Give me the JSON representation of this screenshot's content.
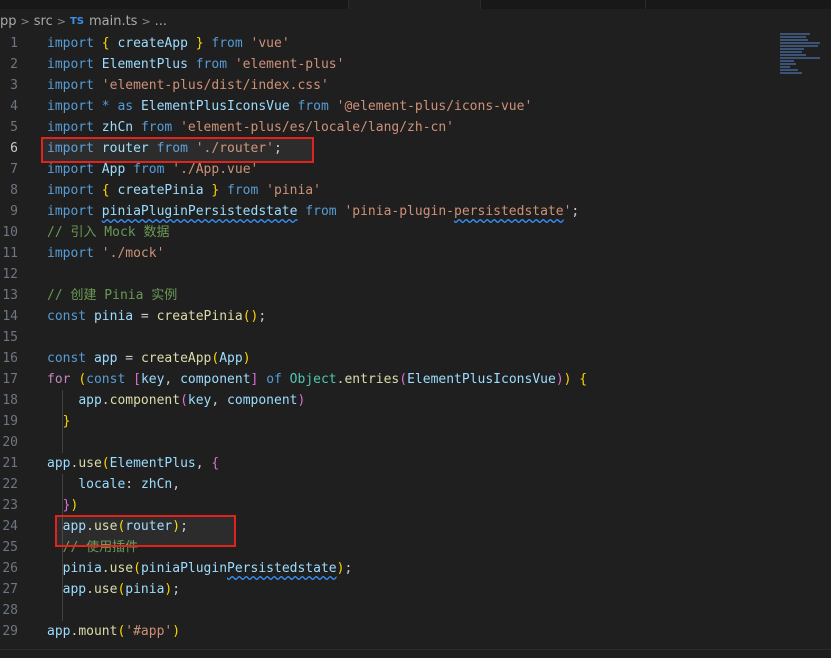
{
  "breadcrumb": {
    "items": [
      "pp",
      "src",
      "main.ts",
      "..."
    ],
    "file_icon": "TS",
    "separator": ">"
  },
  "editor": {
    "current_line": 6,
    "lines": [
      {
        "n": "1",
        "tokens": [
          [
            "kw",
            "import"
          ],
          [
            "plain",
            " "
          ],
          [
            "br1",
            "{"
          ],
          [
            "plain",
            " "
          ],
          [
            "var",
            "createApp"
          ],
          [
            "plain",
            " "
          ],
          [
            "br1",
            "}"
          ],
          [
            "plain",
            " "
          ],
          [
            "kw",
            "from"
          ],
          [
            "plain",
            " "
          ],
          [
            "str",
            "'vue'"
          ]
        ]
      },
      {
        "n": "2",
        "tokens": [
          [
            "kw",
            "import"
          ],
          [
            "plain",
            " "
          ],
          [
            "var",
            "ElementPlus"
          ],
          [
            "plain",
            " "
          ],
          [
            "kw",
            "from"
          ],
          [
            "plain",
            " "
          ],
          [
            "str",
            "'element-plus'"
          ]
        ]
      },
      {
        "n": "3",
        "tokens": [
          [
            "kw",
            "import"
          ],
          [
            "plain",
            " "
          ],
          [
            "str",
            "'element-plus/dist/index.css'"
          ]
        ]
      },
      {
        "n": "4",
        "tokens": [
          [
            "kw",
            "import"
          ],
          [
            "plain",
            " "
          ],
          [
            "kw",
            "*"
          ],
          [
            "plain",
            " "
          ],
          [
            "kw",
            "as"
          ],
          [
            "plain",
            " "
          ],
          [
            "var",
            "ElementPlusIconsVue"
          ],
          [
            "plain",
            " "
          ],
          [
            "kw",
            "from"
          ],
          [
            "plain",
            " "
          ],
          [
            "str",
            "'@element-plus/icons-vue'"
          ]
        ]
      },
      {
        "n": "5",
        "tokens": [
          [
            "kw",
            "import"
          ],
          [
            "plain",
            " "
          ],
          [
            "var",
            "zhCn"
          ],
          [
            "plain",
            " "
          ],
          [
            "kw",
            "from"
          ],
          [
            "plain",
            " "
          ],
          [
            "str",
            "'element-plus/es/locale/lang/zh-cn'"
          ]
        ]
      },
      {
        "n": "6",
        "tokens": [
          [
            "kw",
            "import"
          ],
          [
            "plain",
            " "
          ],
          [
            "var",
            "router"
          ],
          [
            "plain",
            " "
          ],
          [
            "kw",
            "from"
          ],
          [
            "plain",
            " "
          ],
          [
            "str",
            "'./router'"
          ],
          [
            "plain",
            ";"
          ]
        ]
      },
      {
        "n": "7",
        "tokens": [
          [
            "kw",
            "import"
          ],
          [
            "plain",
            " "
          ],
          [
            "var",
            "App"
          ],
          [
            "plain",
            " "
          ],
          [
            "kw",
            "from"
          ],
          [
            "plain",
            " "
          ],
          [
            "str",
            "'./App.vue'"
          ]
        ]
      },
      {
        "n": "8",
        "tokens": [
          [
            "kw",
            "import"
          ],
          [
            "plain",
            " "
          ],
          [
            "br1",
            "{"
          ],
          [
            "plain",
            " "
          ],
          [
            "var",
            "createPinia"
          ],
          [
            "plain",
            " "
          ],
          [
            "br1",
            "}"
          ],
          [
            "plain",
            " "
          ],
          [
            "kw",
            "from"
          ],
          [
            "plain",
            " "
          ],
          [
            "str",
            "'pinia'"
          ]
        ]
      },
      {
        "n": "9",
        "tokens": [
          [
            "kw",
            "import"
          ],
          [
            "plain",
            " "
          ],
          [
            "var squig",
            "piniaPluginPersistedstate"
          ],
          [
            "plain",
            " "
          ],
          [
            "kw",
            "from"
          ],
          [
            "plain",
            " "
          ],
          [
            "str",
            "'pinia-plugin-"
          ],
          [
            "str squig",
            "persistedstate"
          ],
          [
            "str",
            "'"
          ],
          [
            "plain",
            ";"
          ]
        ]
      },
      {
        "n": "10",
        "tokens": [
          [
            "cmt",
            "// 引入 Mock 数据"
          ]
        ]
      },
      {
        "n": "11",
        "tokens": [
          [
            "kw",
            "import"
          ],
          [
            "plain",
            " "
          ],
          [
            "str",
            "'./mock'"
          ]
        ]
      },
      {
        "n": "12",
        "tokens": []
      },
      {
        "n": "13",
        "tokens": [
          [
            "cmt",
            "// 创建 Pinia 实例"
          ]
        ]
      },
      {
        "n": "14",
        "tokens": [
          [
            "kw",
            "const"
          ],
          [
            "plain",
            " "
          ],
          [
            "var",
            "pinia"
          ],
          [
            "plain",
            " = "
          ],
          [
            "fn",
            "createPinia"
          ],
          [
            "br1",
            "()"
          ],
          [
            "plain",
            ";"
          ]
        ]
      },
      {
        "n": "15",
        "tokens": []
      },
      {
        "n": "16",
        "tokens": [
          [
            "kw",
            "const"
          ],
          [
            "plain",
            " "
          ],
          [
            "var",
            "app"
          ],
          [
            "plain",
            " = "
          ],
          [
            "fn",
            "createApp"
          ],
          [
            "br1",
            "("
          ],
          [
            "var",
            "App"
          ],
          [
            "br1",
            ")"
          ]
        ]
      },
      {
        "n": "17",
        "tokens": [
          [
            "ctl",
            "for"
          ],
          [
            "plain",
            " "
          ],
          [
            "br1",
            "("
          ],
          [
            "kw",
            "const"
          ],
          [
            "plain",
            " "
          ],
          [
            "br2",
            "["
          ],
          [
            "var",
            "key"
          ],
          [
            "plain",
            ", "
          ],
          [
            "var",
            "component"
          ],
          [
            "br2",
            "]"
          ],
          [
            "plain",
            " "
          ],
          [
            "kw",
            "of"
          ],
          [
            "plain",
            " "
          ],
          [
            "typ",
            "Object"
          ],
          [
            "plain",
            "."
          ],
          [
            "fn",
            "entries"
          ],
          [
            "br2",
            "("
          ],
          [
            "var",
            "ElementPlusIconsVue"
          ],
          [
            "br2",
            ")"
          ],
          [
            "br1",
            ")"
          ],
          [
            "plain",
            " "
          ],
          [
            "br1",
            "{"
          ]
        ]
      },
      {
        "n": "18",
        "tokens": [
          [
            "plain",
            "    "
          ],
          [
            "var",
            "app"
          ],
          [
            "plain",
            "."
          ],
          [
            "fn",
            "component"
          ],
          [
            "br2",
            "("
          ],
          [
            "var",
            "key"
          ],
          [
            "plain",
            ", "
          ],
          [
            "var",
            "component"
          ],
          [
            "br2",
            ")"
          ]
        ]
      },
      {
        "n": "19",
        "tokens": [
          [
            "plain",
            "  "
          ],
          [
            "br1",
            "}"
          ]
        ]
      },
      {
        "n": "20",
        "tokens": []
      },
      {
        "n": "21",
        "tokens": [
          [
            "var",
            "app"
          ],
          [
            "plain",
            "."
          ],
          [
            "fn",
            "use"
          ],
          [
            "br1",
            "("
          ],
          [
            "var",
            "ElementPlus"
          ],
          [
            "plain",
            ", "
          ],
          [
            "br2",
            "{"
          ]
        ]
      },
      {
        "n": "22",
        "tokens": [
          [
            "plain",
            "    "
          ],
          [
            "var",
            "locale"
          ],
          [
            "plain",
            ": "
          ],
          [
            "var",
            "zhCn"
          ],
          [
            "plain",
            ","
          ]
        ]
      },
      {
        "n": "23",
        "tokens": [
          [
            "plain",
            "  "
          ],
          [
            "br2",
            "}"
          ],
          [
            "br1",
            ")"
          ]
        ]
      },
      {
        "n": "24",
        "tokens": [
          [
            "plain",
            "  "
          ],
          [
            "var",
            "app"
          ],
          [
            "plain",
            "."
          ],
          [
            "fn",
            "use"
          ],
          [
            "br1",
            "("
          ],
          [
            "var",
            "router"
          ],
          [
            "br1",
            ")"
          ],
          [
            "plain",
            ";"
          ]
        ]
      },
      {
        "n": "25",
        "tokens": [
          [
            "plain",
            "  "
          ],
          [
            "cmt",
            "// 使用插件"
          ]
        ]
      },
      {
        "n": "26",
        "tokens": [
          [
            "plain",
            "  "
          ],
          [
            "var",
            "pinia"
          ],
          [
            "plain",
            "."
          ],
          [
            "fn",
            "use"
          ],
          [
            "br1",
            "("
          ],
          [
            "var",
            "piniaPlugin"
          ],
          [
            "var squig",
            "Persistedstate"
          ],
          [
            "br1",
            ")"
          ],
          [
            "plain",
            ";"
          ]
        ]
      },
      {
        "n": "27",
        "tokens": [
          [
            "plain",
            "  "
          ],
          [
            "var",
            "app"
          ],
          [
            "plain",
            "."
          ],
          [
            "fn",
            "use"
          ],
          [
            "br1",
            "("
          ],
          [
            "var",
            "pinia"
          ],
          [
            "br1",
            ")"
          ],
          [
            "plain",
            ";"
          ]
        ]
      },
      {
        "n": "28",
        "tokens": []
      },
      {
        "n": "29",
        "tokens": [
          [
            "var",
            "app"
          ],
          [
            "plain",
            "."
          ],
          [
            "fn",
            "mount"
          ],
          [
            "br1",
            "("
          ],
          [
            "str",
            "'#app'"
          ],
          [
            "br1",
            ")"
          ]
        ]
      }
    ]
  },
  "colors": {
    "background": "#1f1f1f",
    "keyword": "#569cd6",
    "string": "#ce9178",
    "variable": "#9cdcfe",
    "function": "#dcdcaa",
    "comment": "#6a9955",
    "annotation_box": "#e0231d"
  },
  "annotations": [
    {
      "label": "highlight-line-6",
      "line": 6
    },
    {
      "label": "highlight-line-24",
      "line": 24
    }
  ]
}
